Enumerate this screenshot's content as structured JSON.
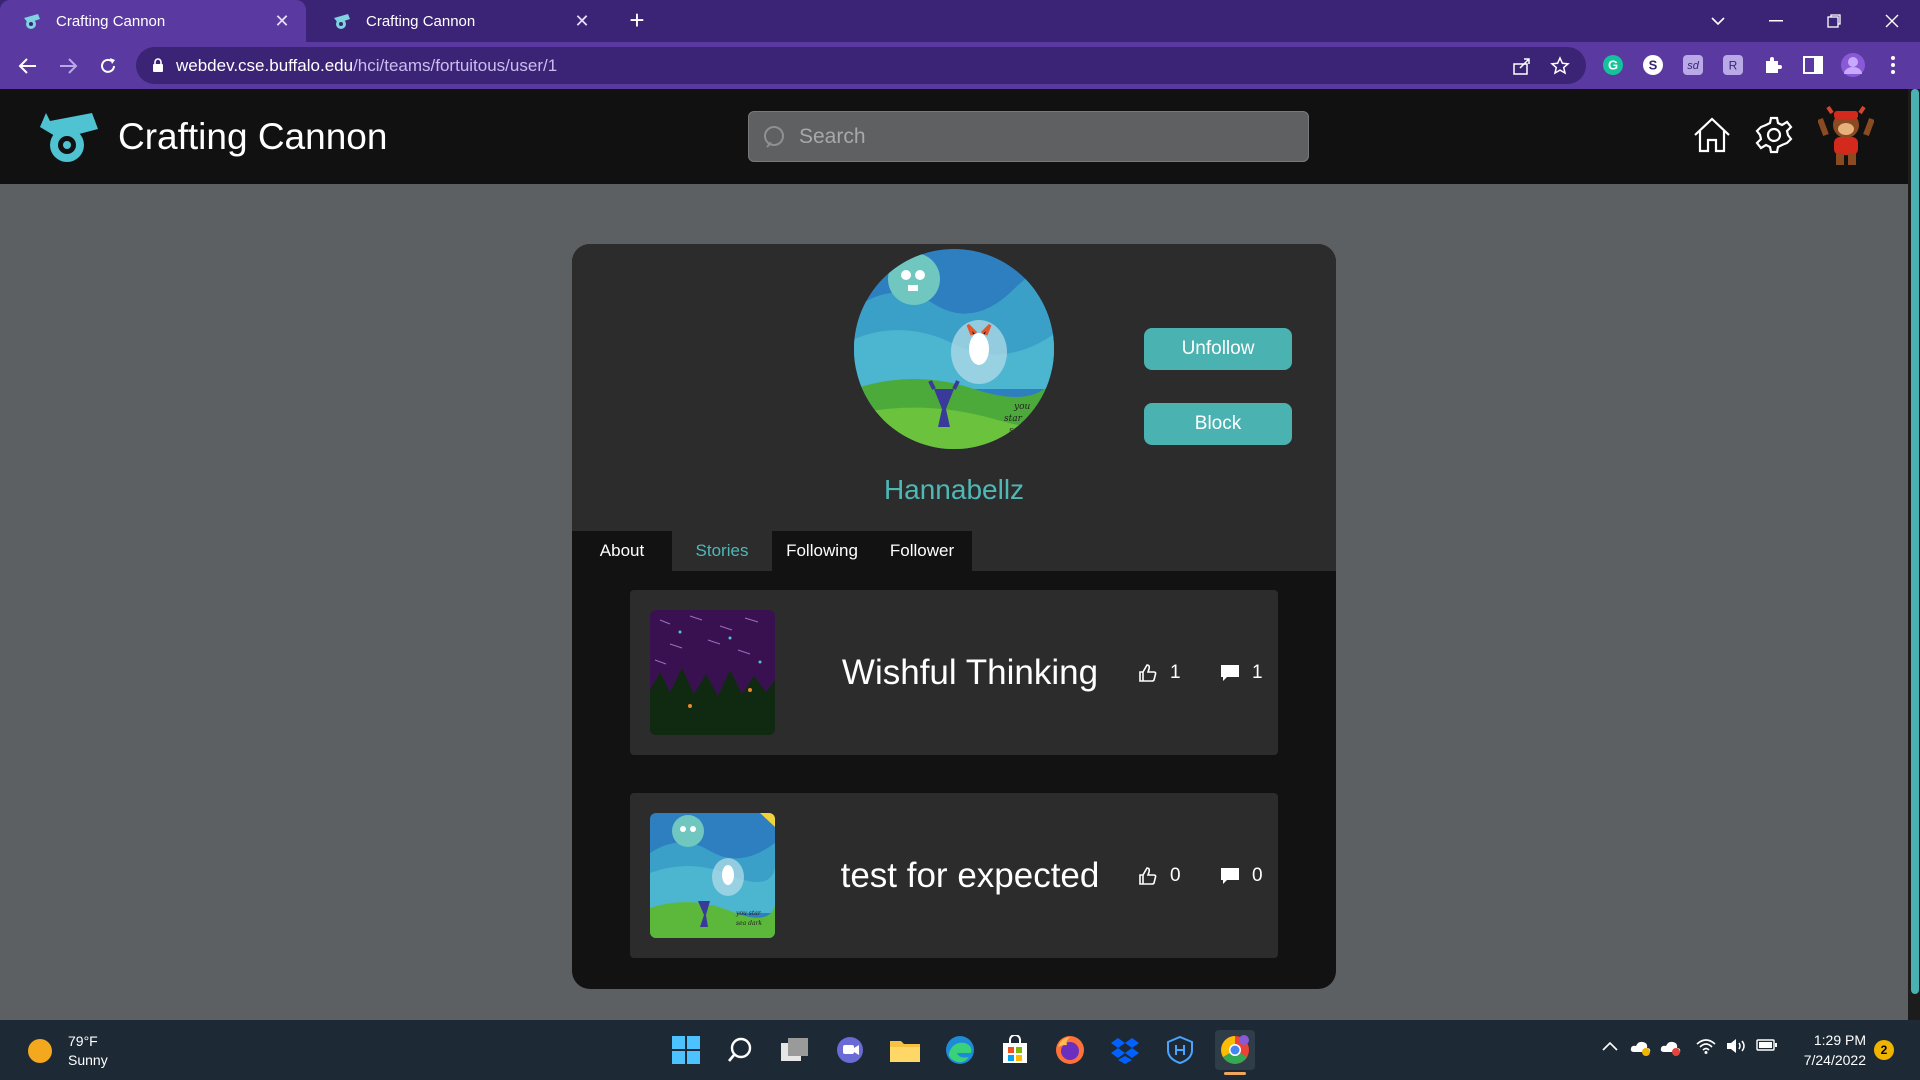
{
  "browser": {
    "tabs": [
      {
        "title": "Crafting Cannon",
        "active": true
      },
      {
        "title": "Crafting Cannon",
        "active": false
      }
    ],
    "url_host": "webdev.cse.buffalo.edu",
    "url_path": "/hci/teams/fortuitous/user/1",
    "new_tab_glyph": "+",
    "close_glyph": "✕"
  },
  "app": {
    "brand_name": "Crafting Cannon",
    "search_placeholder": "Search",
    "accent": "#4ab2b0"
  },
  "profile": {
    "username": "Hannabellz",
    "unfollow_label": "Unfollow",
    "block_label": "Block",
    "tabs": [
      {
        "label": "About",
        "active": false
      },
      {
        "label": "Stories",
        "active": true
      },
      {
        "label": "Following",
        "active": false
      },
      {
        "label": "Follower",
        "active": false
      }
    ]
  },
  "stories": [
    {
      "title": "Wishful Thinking",
      "likes": "1",
      "comments": "1"
    },
    {
      "title": "test for expected",
      "likes": "0",
      "comments": "0"
    }
  ],
  "taskbar": {
    "temperature": "79°F",
    "condition": "Sunny",
    "time": "1:29 PM",
    "date": "7/24/2022",
    "notifications": "2"
  }
}
